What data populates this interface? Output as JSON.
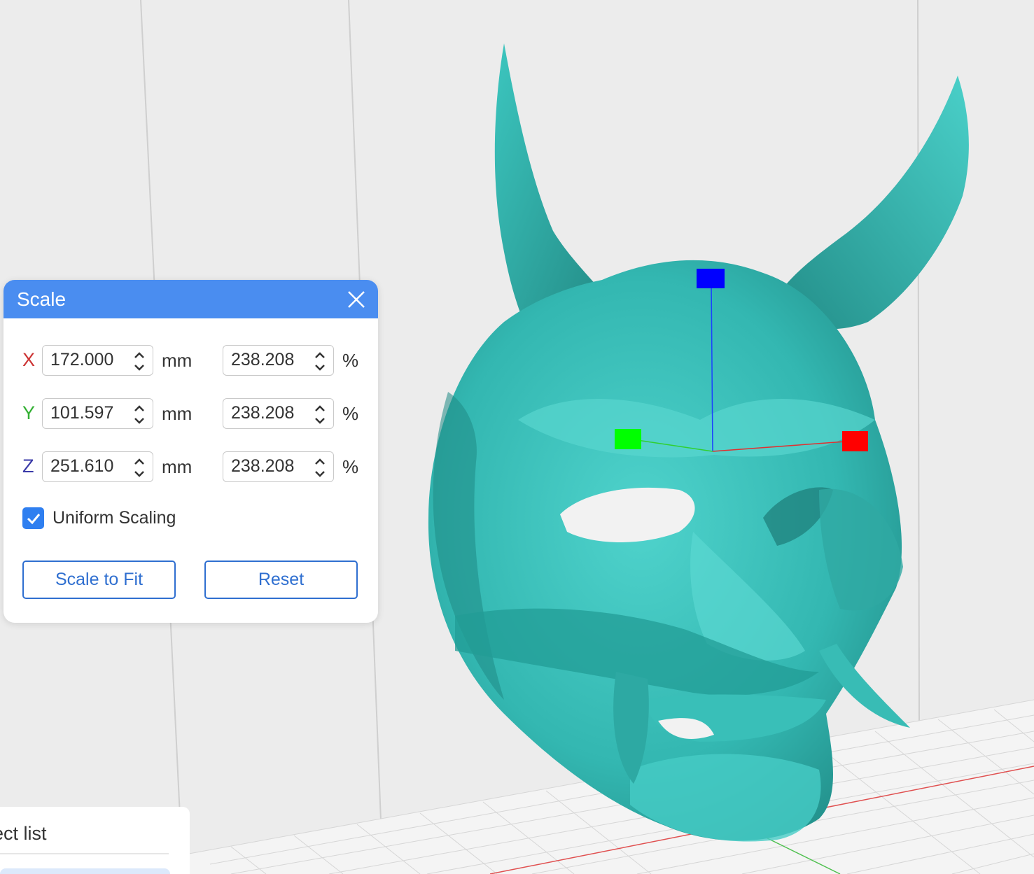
{
  "scale_dialog": {
    "title": "Scale",
    "close_icon": "close-icon",
    "rows": [
      {
        "axis": "X",
        "axis_color": "#cc3333",
        "mm": "172.000",
        "mm_unit": "mm",
        "percent": "238.208",
        "percent_unit": "%"
      },
      {
        "axis": "Y",
        "axis_color": "#33b033",
        "mm": "101.597",
        "mm_unit": "mm",
        "percent": "238.208",
        "percent_unit": "%"
      },
      {
        "axis": "Z",
        "axis_color": "#3a3aa8",
        "mm": "251.610",
        "mm_unit": "mm",
        "percent": "238.208",
        "percent_unit": "%"
      }
    ],
    "uniform_scaling": {
      "label": "Uniform Scaling",
      "checked": true
    },
    "scale_to_fit_label": "Scale to Fit",
    "reset_label": "Reset"
  },
  "object_list": {
    "title": "ect list"
  },
  "colors": {
    "header": "#4a8df0",
    "accent": "#2f7ff0",
    "model": "#3ec3bd",
    "gizmo_x": "#ff0000",
    "gizmo_y": "#00ff00",
    "gizmo_z": "#0000ff"
  }
}
